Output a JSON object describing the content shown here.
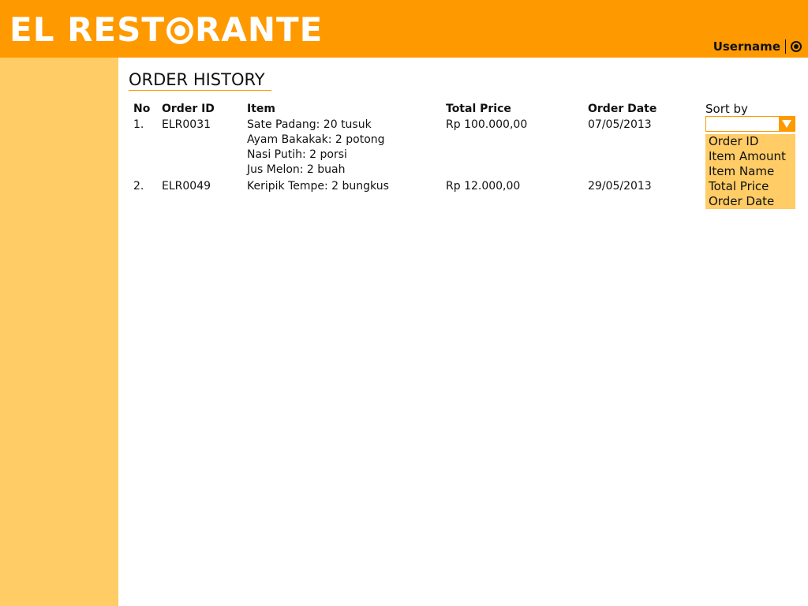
{
  "header": {
    "logo_part1": "EL REST",
    "logo_part2": "RANTE",
    "username": "Username"
  },
  "page": {
    "title": "ORDER HISTORY"
  },
  "table": {
    "columns": [
      "No",
      "Order ID",
      "Item",
      "Total Price",
      "Order Date"
    ],
    "rows": [
      {
        "no": "1.",
        "order_id": "ELR0031",
        "items": [
          "Sate Padang: 20 tusuk",
          "Ayam Bakakak: 2 potong",
          "Nasi Putih: 2 porsi",
          "Jus Melon: 2 buah"
        ],
        "total_price": "Rp 100.000,00",
        "order_date": "07/05/2013"
      },
      {
        "no": "2.",
        "order_id": "ELR0049",
        "items": [
          "Keripik Tempe: 2 bungkus"
        ],
        "total_price": "Rp 12.000,00",
        "order_date": "29/05/2013"
      }
    ]
  },
  "sort": {
    "label": "Sort by",
    "selected": "",
    "options": [
      "Order ID",
      "Item Amount",
      "Item Name",
      "Total Price",
      "Order Date"
    ]
  },
  "colors": {
    "header": "#ff9900",
    "sidebar": "#ffcc66",
    "dropdown_options": "#ffcc66"
  },
  "icons": {
    "logo_o": "logo-o-ring",
    "user": "power-icon",
    "dropdown": "chevron-down-icon"
  }
}
